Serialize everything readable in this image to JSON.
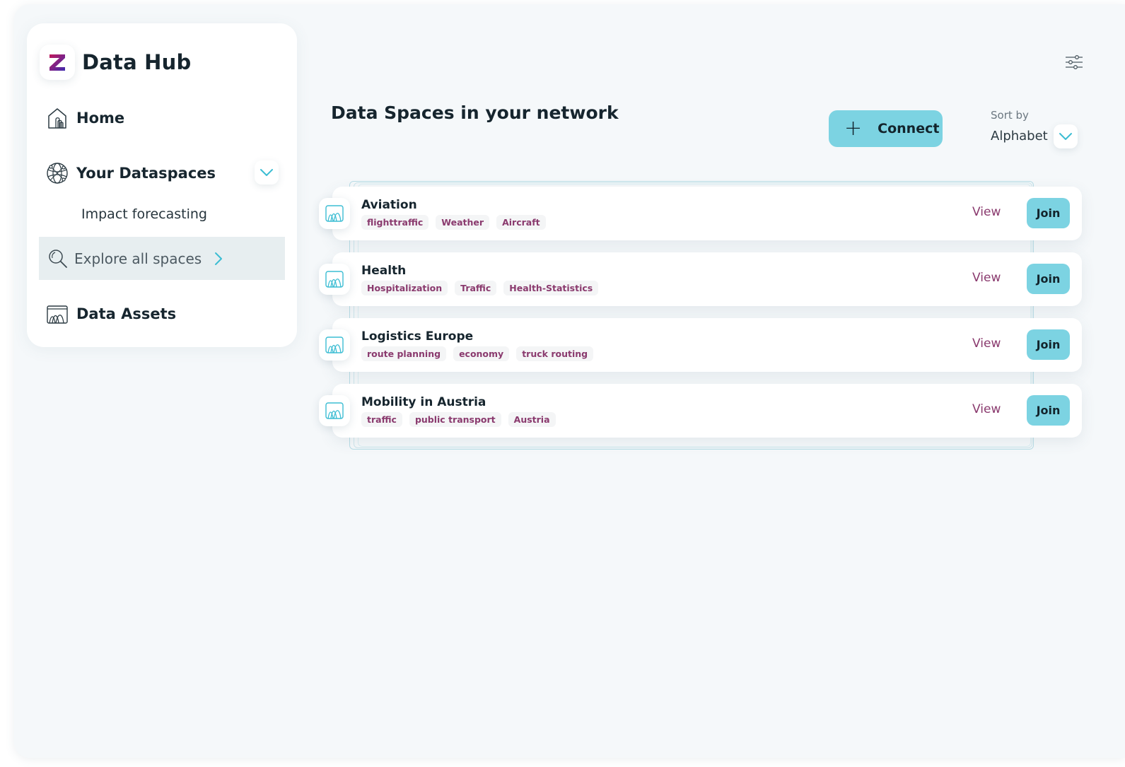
{
  "sidebar": {
    "brand_title": "Data Hub",
    "nav": {
      "home": "Home",
      "dataspaces": "Your Dataspaces",
      "dataspaces_sub": "Impact forecasting",
      "explore": "Explore all spaces",
      "assets": "Data Assets"
    }
  },
  "main": {
    "title": "Data Spaces in your network",
    "connect_label": "Connect",
    "sort": {
      "label": "Sort by",
      "value": "Alphabet"
    },
    "view_label": "View",
    "join_label": "Join",
    "spaces": [
      {
        "name": "Aviation",
        "tags": [
          "flighttraffic",
          "Weather",
          "Aircraft"
        ]
      },
      {
        "name": "Health",
        "tags": [
          "Hospitalization",
          "Traffic",
          "Health-Statistics"
        ]
      },
      {
        "name": "Logistics Europe",
        "tags": [
          "route planning",
          "economy",
          "truck routing"
        ]
      },
      {
        "name": "Mobility in Austria",
        "tags": [
          "traffic",
          "public transport",
          "Austria"
        ]
      }
    ]
  },
  "colors": {
    "accent": "#7cd3e2",
    "tag_text": "#8a3a6e",
    "logo_gradient_start": "#c2185b",
    "logo_gradient_end": "#3f2bb0"
  },
  "icons": {
    "brand": "z-logo-icon",
    "home": "home-icon",
    "dataspaces": "globe-icon",
    "explore": "magnifier-icon",
    "assets": "data-assets-icon",
    "space": "dataspace-icon",
    "filter": "sliders-icon"
  }
}
